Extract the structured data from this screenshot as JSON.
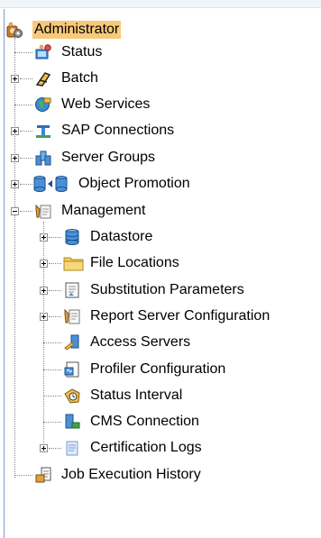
{
  "tree": {
    "root": "Administrator",
    "items": [
      {
        "label": "Status"
      },
      {
        "label": "Batch"
      },
      {
        "label": "Web Services"
      },
      {
        "label": "SAP Connections"
      },
      {
        "label": "Server Groups"
      },
      {
        "label": "Object Promotion"
      },
      {
        "label": "Management"
      },
      {
        "label": "Datastore"
      },
      {
        "label": "File Locations"
      },
      {
        "label": "Substitution Parameters"
      },
      {
        "label": "Report Server Configuration"
      },
      {
        "label": "Access Servers"
      },
      {
        "label": "Profiler Configuration"
      },
      {
        "label": "Status Interval"
      },
      {
        "label": "CMS Connection"
      },
      {
        "label": "Certification Logs"
      },
      {
        "label": "Job Execution History"
      }
    ]
  },
  "colors": {
    "root_highlight": "#f7c97a",
    "tree_lines": "#8a8a8a",
    "panel_border": "#7a9bc6"
  },
  "icons": {
    "root": "admin-gear-icon",
    "status": "status-monitor-icon",
    "batch": "batch-icon",
    "web_services": "web-services-globe-icon",
    "sap": "sap-connection-icon",
    "server_groups": "server-groups-icon",
    "object_promotion": "object-promotion-icon",
    "management": "management-tools-icon",
    "datastore": "datastore-cylinder-icon",
    "file_locations": "folder-icon",
    "substitution": "substitution-doc-icon",
    "report_server": "report-server-icon",
    "access_servers": "access-server-icon",
    "profiler": "profiler-icon",
    "status_interval": "status-interval-icon",
    "cms": "cms-connection-icon",
    "certification": "certification-logs-icon",
    "job_history": "job-history-icon"
  }
}
